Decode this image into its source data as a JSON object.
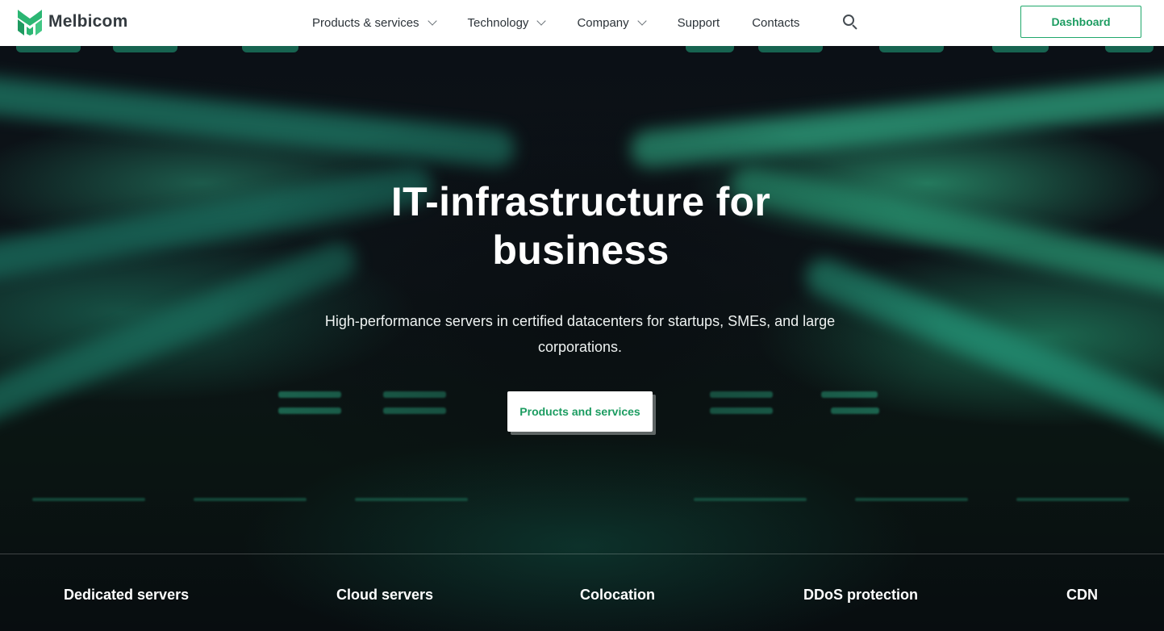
{
  "brand": {
    "name": "Melbicom",
    "logo_icon": "melbicom-logo-icon",
    "accent_color": "#20a86b"
  },
  "nav": {
    "items": [
      {
        "label": "Products & services",
        "dropdown": true
      },
      {
        "label": "Technology",
        "dropdown": true
      },
      {
        "label": "Company",
        "dropdown": true
      },
      {
        "label": "Support",
        "dropdown": false
      },
      {
        "label": "Contacts",
        "dropdown": false
      }
    ],
    "search_icon": "search-icon",
    "dashboard_label": "Dashboard"
  },
  "hero": {
    "title_line1": "IT-infrastructure for",
    "title_line2": "business",
    "subtitle": "High-performance servers in certified datacenters for startups, SMEs, and large corporations.",
    "cta_label": "Products and services"
  },
  "categories": [
    {
      "label": "Dedicated servers"
    },
    {
      "label": "Cloud servers"
    },
    {
      "label": "Colocation"
    },
    {
      "label": "DDoS protection"
    },
    {
      "label": "CDN"
    }
  ]
}
